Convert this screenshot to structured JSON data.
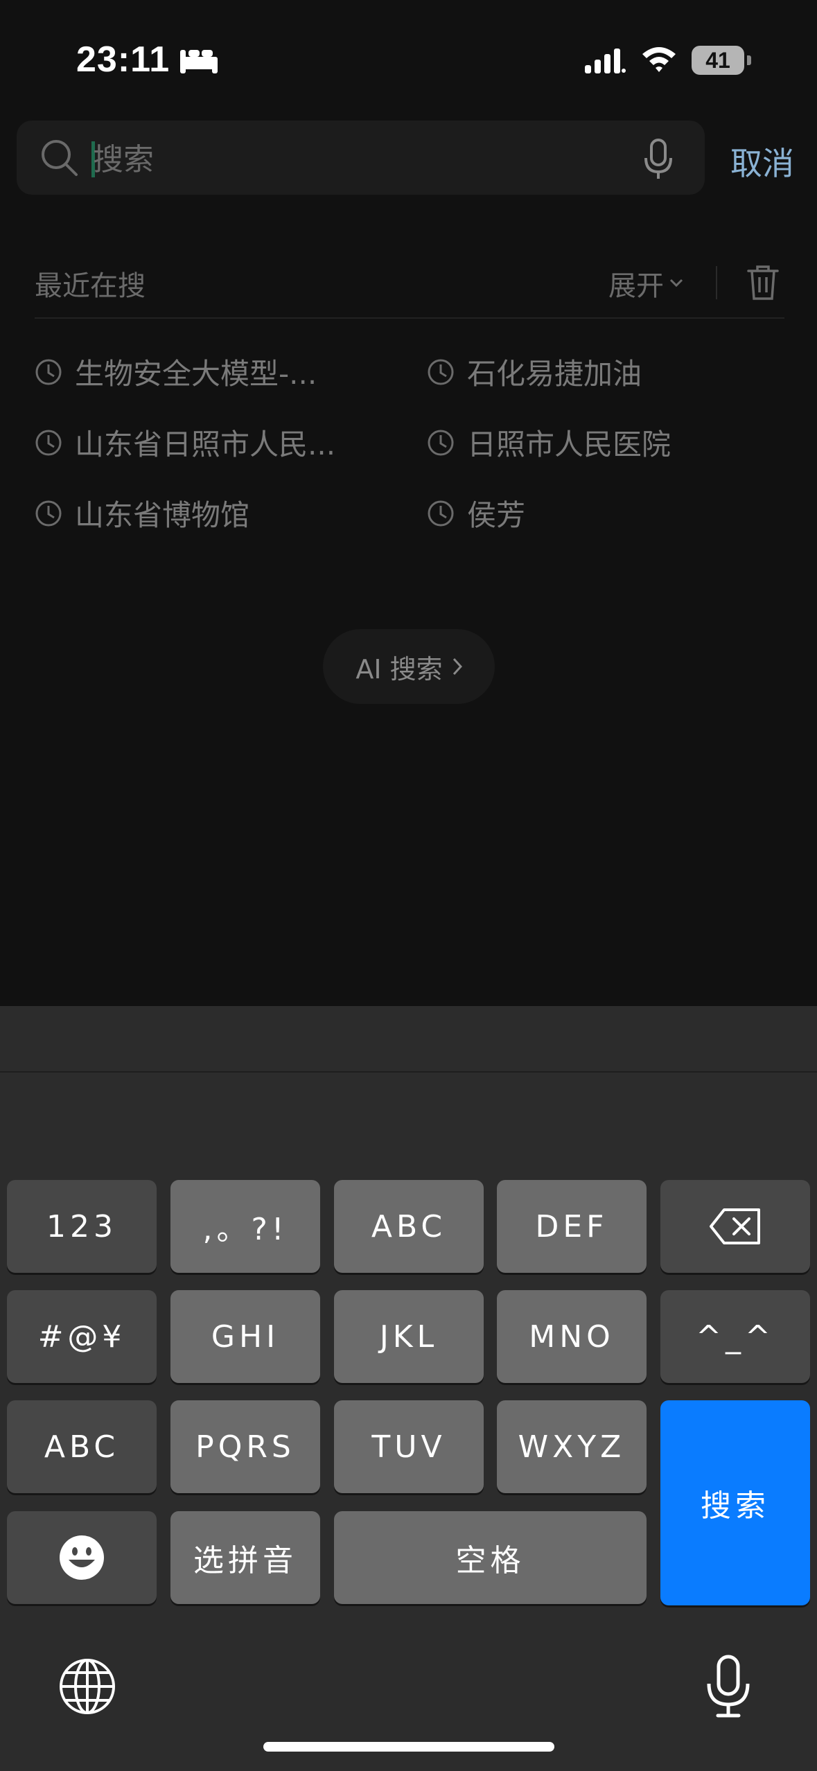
{
  "status_bar": {
    "time": "23:11",
    "battery": "41",
    "icons": [
      "sleep-icon",
      "signal-icon",
      "wifi-icon",
      "battery-icon"
    ]
  },
  "search": {
    "placeholder": "搜索",
    "value": "",
    "cancel_label": "取消",
    "icons": [
      "search-icon",
      "microphone-icon"
    ]
  },
  "recent": {
    "title": "最近在搜",
    "expand_label": "展开",
    "items": [
      {
        "label": "生物安全大模型-..."
      },
      {
        "label": "石化易捷加油"
      },
      {
        "label": "山东省日照市人民..."
      },
      {
        "label": "日照市人民医院"
      },
      {
        "label": "山东省博物馆"
      },
      {
        "label": "侯芳"
      }
    ]
  },
  "ai_search": {
    "label": "AI 搜索"
  },
  "keyboard": {
    "keys": {
      "num": "123",
      "punct": ",。?!",
      "abc_letters": "ABC",
      "def": "DEF",
      "symbols": "#@¥",
      "ghi": "GHI",
      "jkl": "JKL",
      "mno": "MNO",
      "emoticon": "^_^",
      "abc_mode": "ABC",
      "pqrs": "PQRS",
      "tuv": "TUV",
      "wxyz": "WXYZ",
      "search": "搜索",
      "pinyin": "选拼音",
      "space": "空格"
    },
    "colors": {
      "search_key": "#0a7cff",
      "light_key": "#6b6b6b",
      "dark_key": "#474747"
    }
  }
}
